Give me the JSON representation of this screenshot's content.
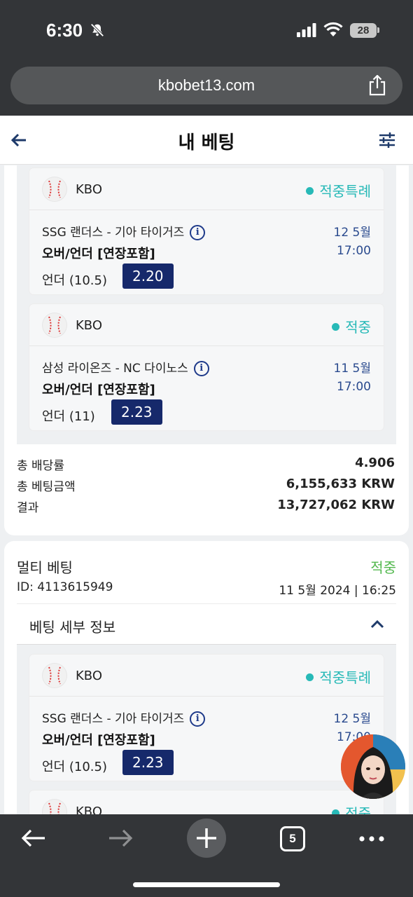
{
  "status_bar": {
    "time": "6:30",
    "battery": "28"
  },
  "browser": {
    "url": "kbobet13.com",
    "open_tabs": "5"
  },
  "header": {
    "title": "내 베팅"
  },
  "bet1": {
    "legs": [
      {
        "league": "KBO",
        "status": "적중특례",
        "match": "SSG 랜더스 - 기아 타이거즈",
        "market": "오버/언더 [연장포함]",
        "pick": "언더 (10.5)",
        "odds": "2.20",
        "date": "12 5월",
        "time": "17:00"
      },
      {
        "league": "KBO",
        "status": "적중",
        "match": "삼성 라이온즈 - NC 다이노스",
        "market": "오버/언더 [연장포함]",
        "pick": "언더 (11)",
        "odds": "2.23",
        "date": "11 5월",
        "time": "17:00"
      }
    ],
    "summary": [
      {
        "label": "총 배당률",
        "value": "4.906"
      },
      {
        "label": "총 베팅금액",
        "value": "6,155,633 KRW"
      },
      {
        "label": "결과",
        "value": "13,727,062 KRW"
      }
    ]
  },
  "bet2": {
    "title": "멀티 베팅",
    "status": "적중",
    "id": "ID: 4113615949",
    "datetime": "11 5월 2024 | 16:25",
    "details_label": "베팅 세부 정보",
    "legs": [
      {
        "league": "KBO",
        "status": "적중특례",
        "match": "SSG 랜더스 - 기아 타이거즈",
        "market": "오버/언더 [연장포함]",
        "pick": "언더 (10.5)",
        "odds": "2.23",
        "date": "12 5월",
        "time": "17:00"
      },
      {
        "league": "KBO",
        "status": "적중"
      }
    ]
  },
  "colors": {
    "status_teal": "#27b9b7",
    "status_green": "#52b84e",
    "odds_navy": "#16296b"
  }
}
